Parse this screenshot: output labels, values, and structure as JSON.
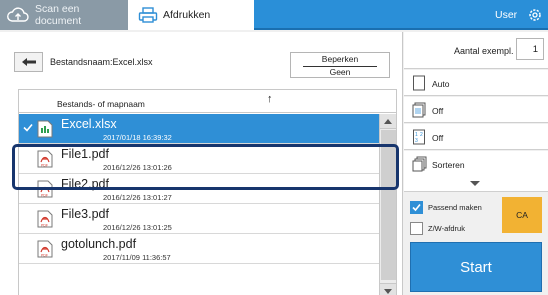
{
  "tabs": [
    {
      "label": "Scan een document",
      "icon": "cloud-upload-icon",
      "active": false
    },
    {
      "label": "Afdrukken",
      "icon": "printer-icon",
      "active": true
    }
  ],
  "header": {
    "user_label": "User",
    "settings_icon": "gear-icon"
  },
  "path_bar": {
    "filename_label": "Bestandsnaam:Excel.xlsx",
    "limit_button": {
      "line1": "Beperken",
      "line2": "Geen"
    }
  },
  "file_list": {
    "header_label": "Bestands- of mapnaam",
    "sort_indicator": "↑",
    "rows": [
      {
        "name": "Excel.xlsx",
        "date": "2017/01/18 16:39:32",
        "type": "xlsx",
        "selected": true
      },
      {
        "name": "File1.pdf",
        "date": "2016/12/26 13:01:26",
        "type": "pdf",
        "selected": false
      },
      {
        "name": "File2.pdf",
        "date": "2016/12/26 13:01:27",
        "type": "pdf",
        "selected": false
      },
      {
        "name": "File3.pdf",
        "date": "2016/12/26 13:01:25",
        "type": "pdf",
        "selected": false
      },
      {
        "name": "gotolunch.pdf",
        "date": "2017/11/09 11:36:57",
        "type": "pdf",
        "selected": false
      }
    ]
  },
  "settings": {
    "copies_label": "Aantal exempl.",
    "copies_value": "1",
    "options": [
      {
        "label": "Auto",
        "icon": "page-icon"
      },
      {
        "label": "Off",
        "icon": "duplex-icon"
      },
      {
        "label": "Off",
        "icon": "multi-page-icon"
      },
      {
        "label": "Sorteren",
        "icon": "collate-icon"
      }
    ],
    "fit_to_page": {
      "label": "Passend maken",
      "checked": true
    },
    "bw_print": {
      "label": "Z/W-afdruk",
      "checked": false
    },
    "paper_size": "CA",
    "start_label": "Start"
  },
  "colors": {
    "accent": "#2f8fd6",
    "topbar": "#2a8fd8",
    "focus": "#17356d",
    "paper_badge": "#f2b233"
  }
}
